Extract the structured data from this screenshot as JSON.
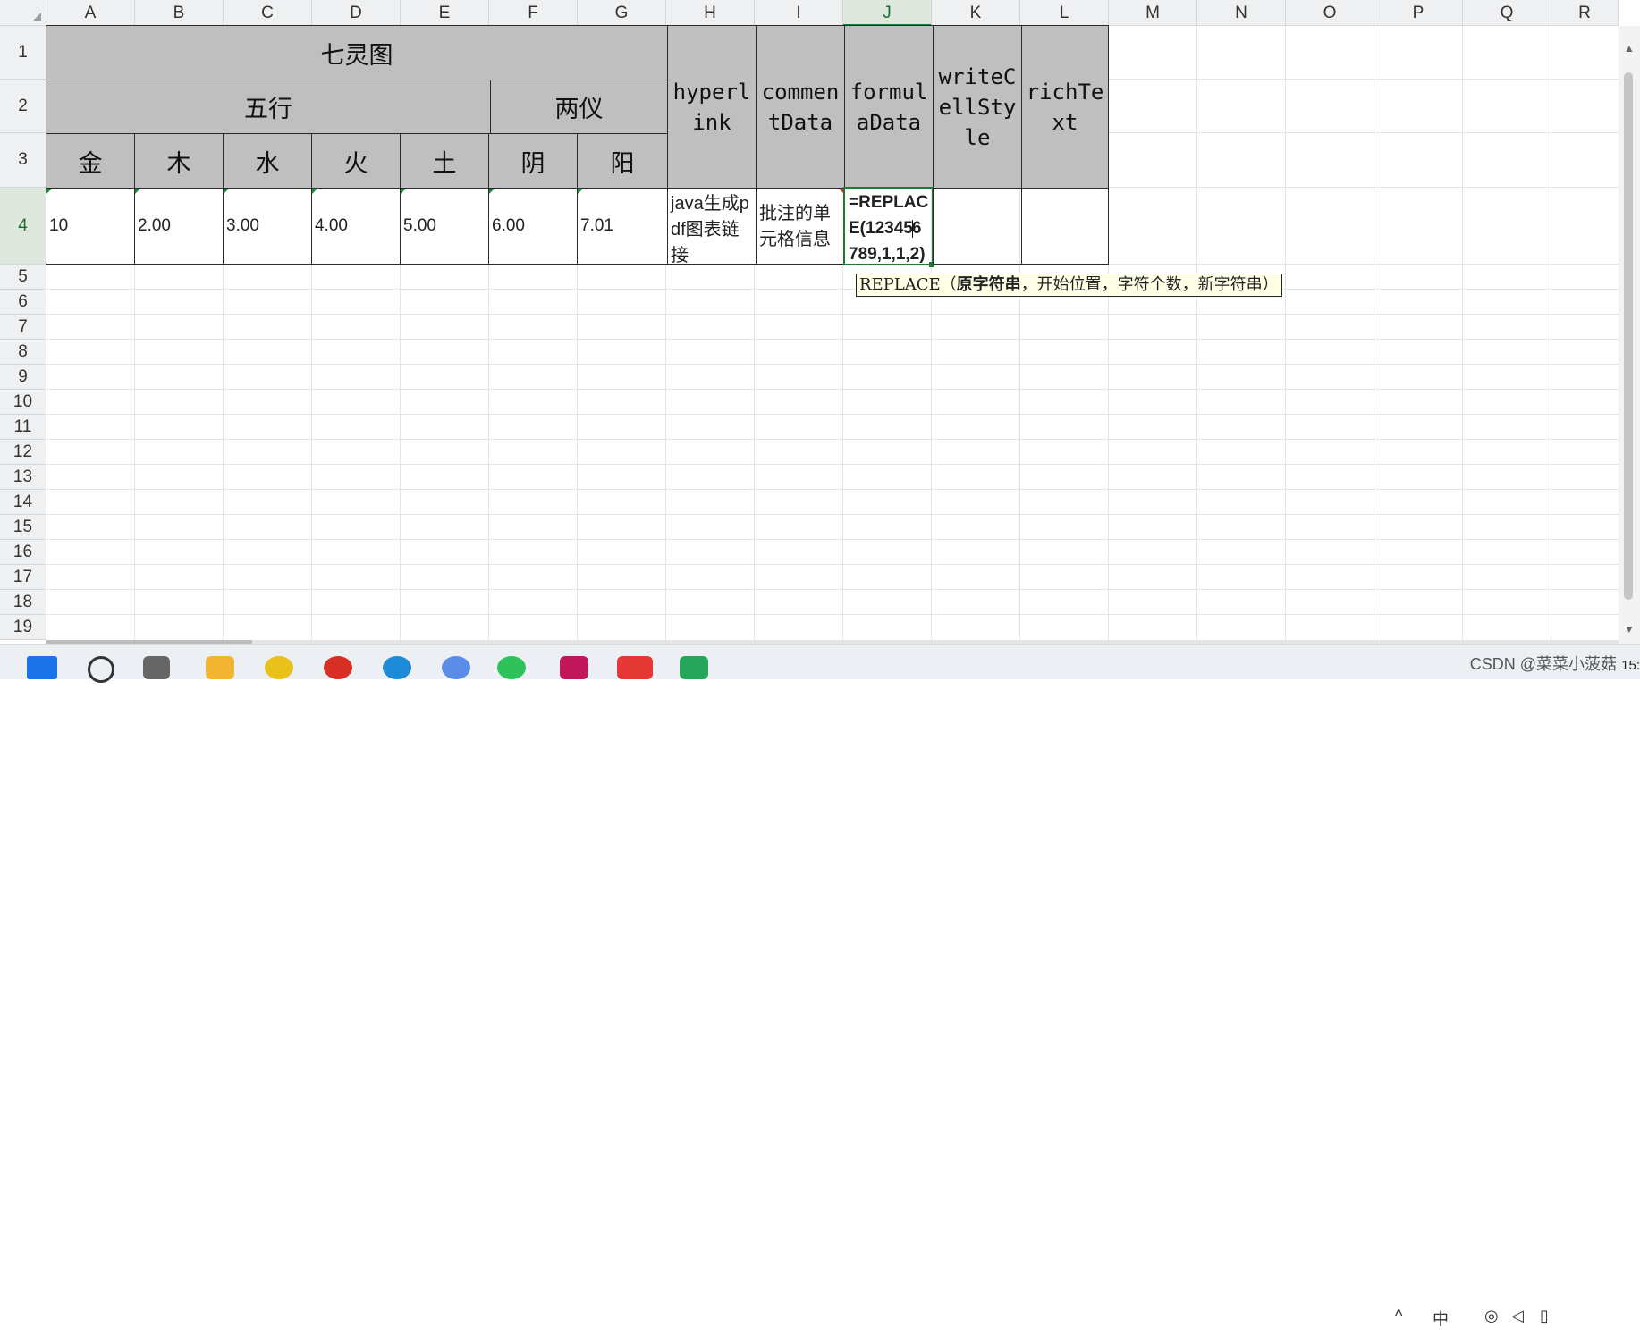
{
  "columns": [
    "A",
    "B",
    "C",
    "D",
    "E",
    "F",
    "G",
    "H",
    "I",
    "J",
    "K",
    "L",
    "M",
    "N",
    "O",
    "P",
    "Q",
    "R"
  ],
  "rows": [
    "1",
    "2",
    "3",
    "4",
    "5",
    "6",
    "7",
    "8",
    "9",
    "10",
    "11",
    "12",
    "13",
    "14",
    "15",
    "16",
    "17",
    "18",
    "19"
  ],
  "active_column": "J",
  "active_row": "4",
  "table": {
    "title": "七灵图",
    "group_wuxing": "五行",
    "group_liangyi": "两仪",
    "sub_headers": [
      "金",
      "木",
      "水",
      "火",
      "土",
      "阴",
      "阳"
    ],
    "hyperlink_header": "hyperlink",
    "comment_header": "commentData",
    "formula_header": "formulaData",
    "writecellstyle_header": "writeCellStyle",
    "richtext_header": "richText",
    "values": [
      "10",
      "2.00",
      "3.00",
      "4.00",
      "5.00",
      "6.00",
      "7.01"
    ],
    "hyperlink_value": "java生成pdf图表链接",
    "comment_value": "批注的单元格信息",
    "formula_before_caret": "=REPLACE(12345",
    "formula_after_caret": "6789,1,1,2)"
  },
  "tooltip": {
    "func": "REPLACE",
    "open": "（",
    "arg_current": "原字符串",
    "args_rest": "，开始位置，字符个数，新字符串",
    "close": "）"
  },
  "taskbar": {
    "watermark": "CSDN @菜菜小菠菇",
    "ime": "中",
    "clock": "15:"
  },
  "colors": {
    "header_fill": "#bfbfbf",
    "selection": "#1b7a33"
  }
}
